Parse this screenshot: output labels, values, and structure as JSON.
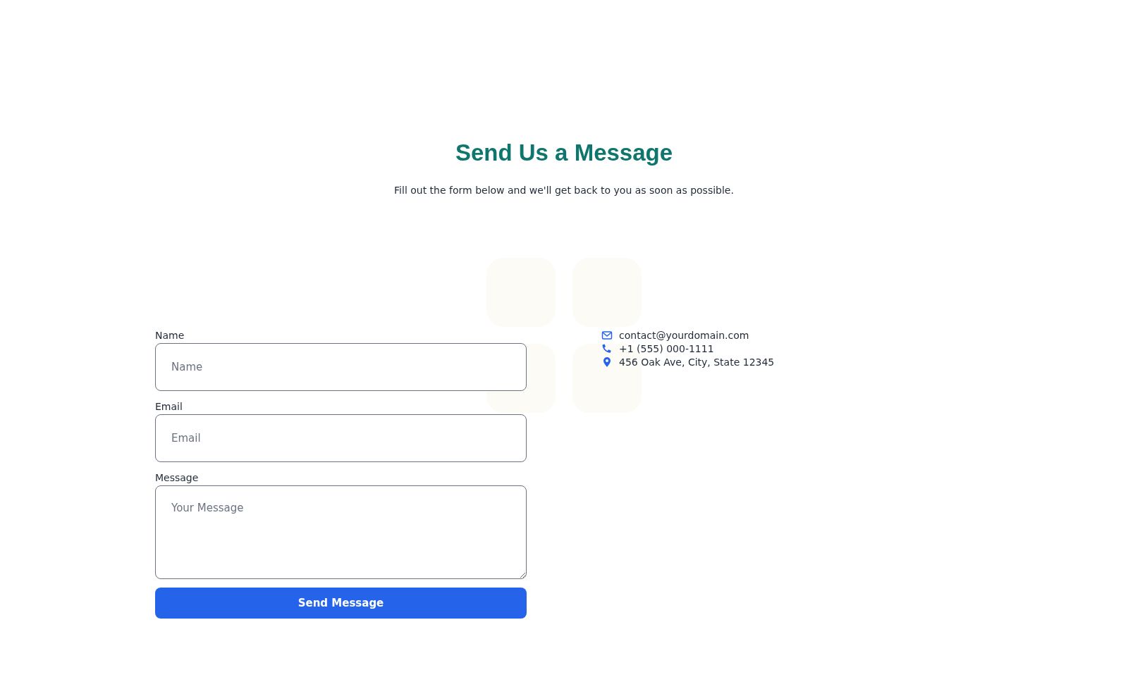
{
  "heading": "Send Us a Message",
  "subtitle": "Fill out the form below and we'll get back to you as soon as possible.",
  "form": {
    "fields": [
      {
        "kind": "input",
        "label": "Name",
        "placeholder": "Name"
      },
      {
        "kind": "input",
        "label": "Email",
        "placeholder": "Email"
      },
      {
        "kind": "textarea",
        "label": "Message",
        "placeholder": "Your Message"
      }
    ],
    "submit": "Send Message"
  },
  "contact": [
    {
      "kind": "email",
      "text": "contact@yourdomain.com"
    },
    {
      "kind": "phone",
      "text": "+1 (555) 000-1111"
    },
    {
      "kind": "address",
      "text": "456 Oak Ave, City, State 12345"
    }
  ]
}
